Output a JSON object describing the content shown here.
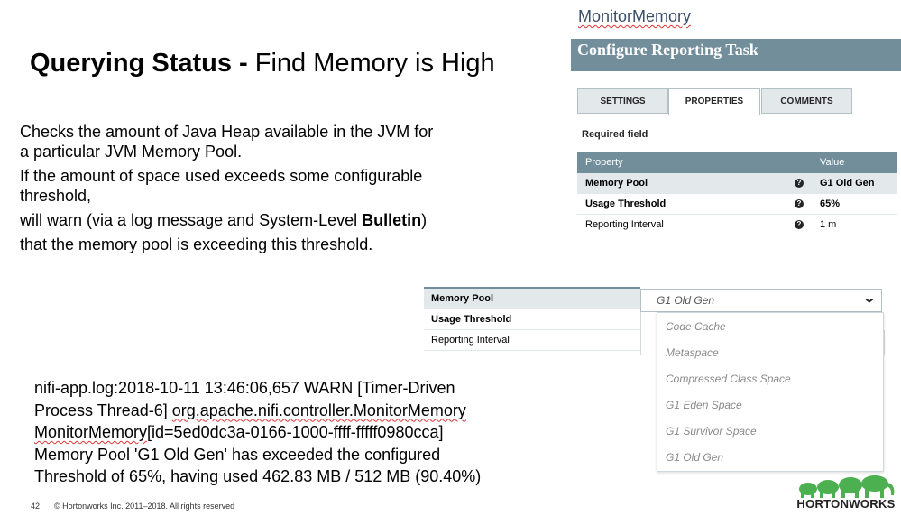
{
  "slide": {
    "title_bold": "Querying Status -",
    "title_rest": " Find Memory is High",
    "description": [
      "Checks the amount of Java Heap available in the JVM for a particular JVM Memory Pool.",
      "If the amount of space used exceeds some configurable threshold,",
      "will warn (via a log message and System-Level ",
      "that the memory pool is exceeding this threshold."
    ],
    "bulletin_word": "Bulletin",
    "bulletin_close": ")",
    "log": {
      "line1": "nifi-app.log:2018-10-11 13:46:06,657 WARN [Timer-Driven",
      "line2_prefix": "Process Thread-6] ",
      "line2_class": "org.apache.nifi.controller.MonitorMemory",
      "line3_name": "MonitorMemory",
      "line3_rest": "[id=5ed0dc3a-0166-1000-ffff-fffff0980cca]",
      "line4": "Memory Pool 'G1 Old Gen' has exceeded the configured",
      "line5": "Threshold of 65%, having used 462.83 MB / 512 MB (90.40%)"
    },
    "footer_page": "42",
    "footer_copyright": "© Hortonworks Inc. 2011–2018. All rights reserved"
  },
  "dialog": {
    "processor_name": "MonitorMemory",
    "header": "Configure Reporting Task",
    "tabs": [
      "SETTINGS",
      "PROPERTIES",
      "COMMENTS"
    ],
    "active_tab": "PROPERTIES",
    "required_field": "Required field",
    "table": {
      "col_property": "Property",
      "col_value": "Value",
      "rows": [
        {
          "name": "Memory Pool",
          "value": "G1 Old Gen",
          "required": true
        },
        {
          "name": "Usage Threshold",
          "value": "65%",
          "required": true
        },
        {
          "name": "Reporting Interval",
          "value": "1 m",
          "required": false
        }
      ]
    },
    "help_glyph": "?"
  },
  "lower_table": {
    "rows": [
      "Memory Pool",
      "Usage Threshold",
      "Reporting Interval"
    ]
  },
  "dropdown": {
    "selected": "G1 Old Gen",
    "options": [
      "Code Cache",
      "Metaspace",
      "Compressed Class Space",
      "G1 Eden Space",
      "G1 Survivor Space",
      "G1 Old Gen"
    ]
  },
  "logo": {
    "text": "HORTONWORKS",
    "color": "#4caf50"
  }
}
